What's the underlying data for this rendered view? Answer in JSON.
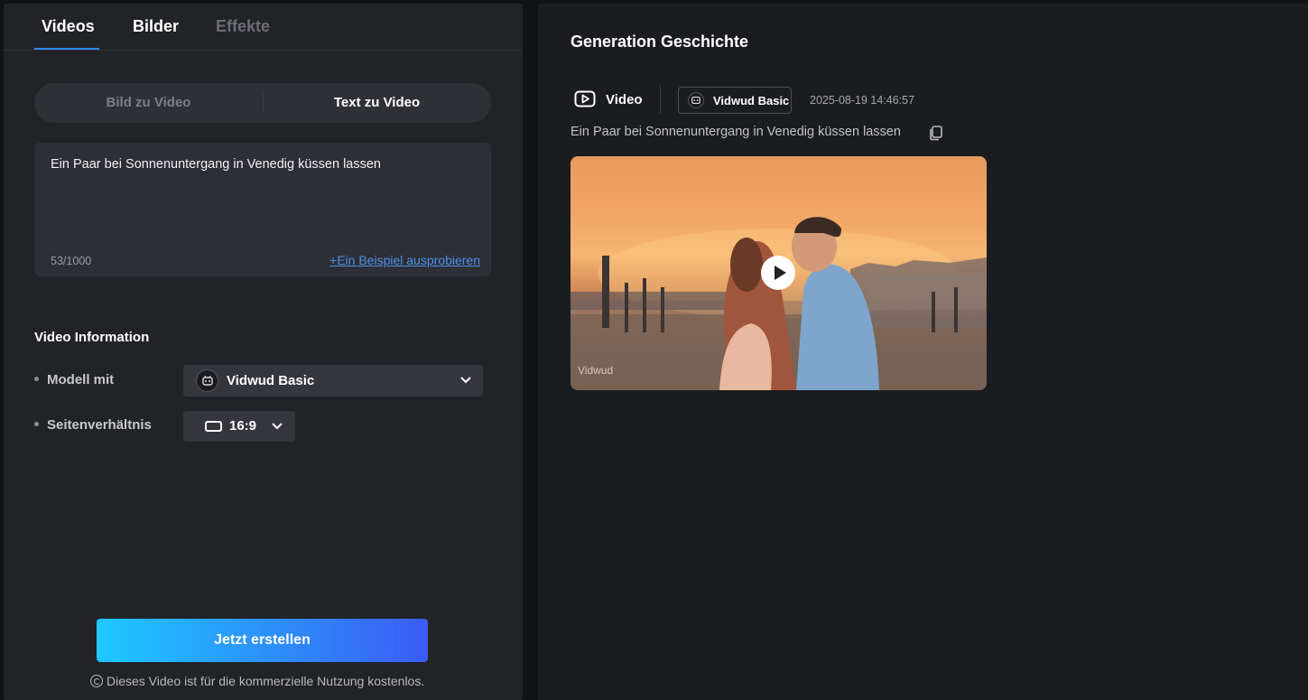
{
  "tabs": [
    {
      "label": "Videos",
      "active": true
    },
    {
      "label": "Bilder",
      "active": false
    },
    {
      "label": "Effekte",
      "active": false
    }
  ],
  "mode_switch": {
    "options": [
      "Bild zu Video",
      "Text zu Video"
    ],
    "selected": "Text zu Video"
  },
  "prompt": {
    "value": "Ein Paar bei Sonnenuntergang in Venedig küssen lassen",
    "counter": "53/1000",
    "example_link": "+Ein Beispiel ausprobieren"
  },
  "video_info": {
    "title": "Video Information",
    "model_label": "Modell mit",
    "model_value": "Vidwud Basic",
    "ratio_label": "Seitenverhältnis",
    "ratio_value": "16:9"
  },
  "create_button": "Jetzt erstellen",
  "license_note": "Dieses Video ist für die kommerzielle Nutzung kostenlos.",
  "history": {
    "title": "Generation Geschichte",
    "entry": {
      "type": "Video",
      "model": "Vidwud Basic",
      "timestamp": "2025-08-19 14:46:57",
      "prompt": "Ein Paar bei Sonnenuntergang in Venedig küssen lassen",
      "watermark": "Vidwud"
    }
  },
  "colors": {
    "accent_blue": "#2f8cff",
    "link": "#4f8fe8",
    "button_gradient_start": "#1ec9ff",
    "button_gradient_end": "#3a5cf5"
  }
}
